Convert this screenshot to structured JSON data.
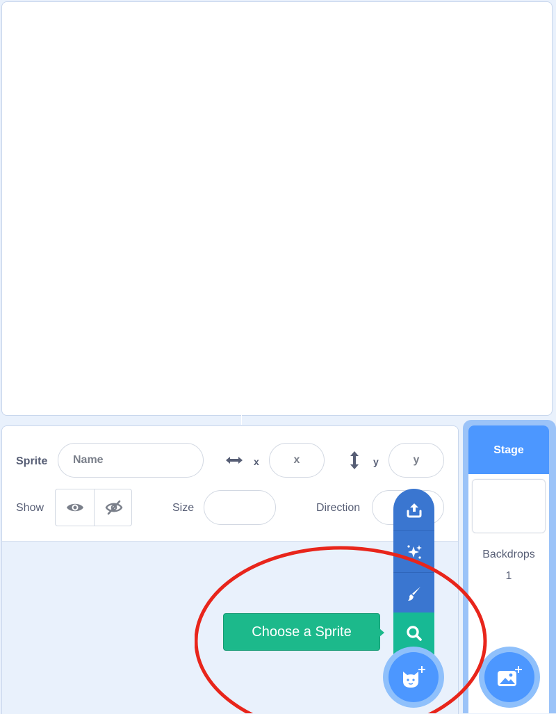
{
  "sprite_info": {
    "sprite_label": "Sprite",
    "name_placeholder": "Name",
    "x_label": "x",
    "x_placeholder": "x",
    "y_label": "y",
    "y_placeholder": "y",
    "show_label": "Show",
    "size_label": "Size",
    "direction_label": "Direction"
  },
  "sprite_menu": {
    "items": [
      {
        "icon": "upload-icon"
      },
      {
        "icon": "surprise-sparkle-icon"
      },
      {
        "icon": "paint-brush-icon"
      },
      {
        "icon": "search-icon"
      }
    ],
    "tooltip": "Choose a Sprite",
    "main_button_icon": "sprite-cat-plus-icon"
  },
  "stage": {
    "title": "Stage",
    "backdrops_label": "Backdrops",
    "backdrops_count": "1",
    "add_backdrop_icon": "backdrop-image-plus-icon"
  },
  "colors": {
    "primary_blue": "#4c97ff",
    "menu_blue": "#3a76d0",
    "search_green": "#17b994",
    "tooltip_green": "#1cb98b",
    "annotation_red": "#e8251b"
  }
}
